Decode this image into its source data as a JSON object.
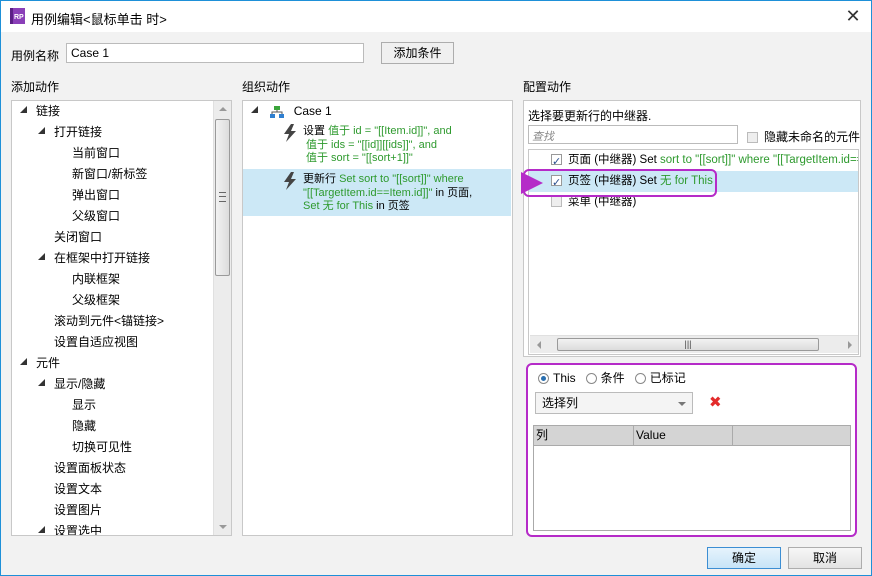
{
  "window": {
    "title": "用例编辑<鼠标单击 时>",
    "app_icon_label": "RP",
    "close_glyph": "✕"
  },
  "case_name": {
    "label": "用例名称",
    "value": "Case 1",
    "add_condition_label": "添加条件"
  },
  "add_actions": {
    "heading": "添加动作",
    "items": [
      {
        "label": "链接",
        "level": 0,
        "expandable": true
      },
      {
        "label": "打开链接",
        "level": 1,
        "expandable": true
      },
      {
        "label": "当前窗口",
        "level": 2,
        "expandable": false
      },
      {
        "label": "新窗口/新标签",
        "level": 2,
        "expandable": false
      },
      {
        "label": "弹出窗口",
        "level": 2,
        "expandable": false
      },
      {
        "label": "父级窗口",
        "level": 2,
        "expandable": false
      },
      {
        "label": "关闭窗口",
        "level": 1,
        "expandable": false
      },
      {
        "label": "在框架中打开链接",
        "level": 1,
        "expandable": true
      },
      {
        "label": "内联框架",
        "level": 2,
        "expandable": false
      },
      {
        "label": "父级框架",
        "level": 2,
        "expandable": false
      },
      {
        "label": "滚动到元件<锚链接>",
        "level": 1,
        "expandable": false
      },
      {
        "label": "设置自适应视图",
        "level": 1,
        "expandable": false
      },
      {
        "label": "元件",
        "level": 0,
        "expandable": true
      },
      {
        "label": "显示/隐藏",
        "level": 1,
        "expandable": true
      },
      {
        "label": "显示",
        "level": 2,
        "expandable": false
      },
      {
        "label": "隐藏",
        "level": 2,
        "expandable": false
      },
      {
        "label": "切换可见性",
        "level": 2,
        "expandable": false
      },
      {
        "label": "设置面板状态",
        "level": 1,
        "expandable": false
      },
      {
        "label": "设置文本",
        "level": 1,
        "expandable": false
      },
      {
        "label": "设置图片",
        "level": 1,
        "expandable": false
      },
      {
        "label": "设置选中",
        "level": 1,
        "expandable": true
      }
    ]
  },
  "organize_actions": {
    "heading": "组织动作",
    "case_label": "Case 1",
    "actions": [
      {
        "verb": "设置",
        "lines": [
          {
            "green": "值于 id = \"[[Item.id]]\", and"
          },
          {
            "green": "值于 ids = \"[[id]][[ids]]\", and"
          },
          {
            "green": "值于 sort = \"[[sort+1]]\""
          }
        ],
        "selected": false
      },
      {
        "verb": "更新行",
        "line1_green": "Set sort to \"[[sort]]\" where",
        "line2_green": "\"[[TargetItem.id==Item.id]]\"",
        "line2_black": " in 页面,",
        "line3_green": "Set 无 for This",
        "line3_black": " in 页签",
        "selected": true
      }
    ]
  },
  "configure_actions": {
    "heading": "配置动作",
    "prompt": "选择要更新行的中继器.",
    "search_placeholder": "查找",
    "hide_unnamed_label": "隐藏未命名的元件",
    "repeaters": [
      {
        "name": "页面 (中继器) Set ",
        "detail": "sort to \"[[sort]]\" where \"[[TargetItem.id==It",
        "checked": true,
        "selected": false
      },
      {
        "name": "页签 (中继器) Set ",
        "detail": "无 for This",
        "checked": true,
        "selected": true
      },
      {
        "name": "菜单 (中继器)",
        "detail": "",
        "checked": false,
        "selected": false
      }
    ],
    "row_mode": {
      "options": [
        "This",
        "条件",
        "已标记"
      ],
      "selected": "This"
    },
    "column_select": "选择列",
    "table_headers": [
      "列",
      "Value",
      ""
    ],
    "table_rows": []
  },
  "footer": {
    "ok_label": "确定",
    "cancel_label": "取消"
  },
  "colors": {
    "accent_border": "#1e90d8",
    "highlight": "#b52bc8",
    "selection": "#cce8f6",
    "green_text": "#2e9a2e",
    "delete_red": "#e32b2b"
  }
}
